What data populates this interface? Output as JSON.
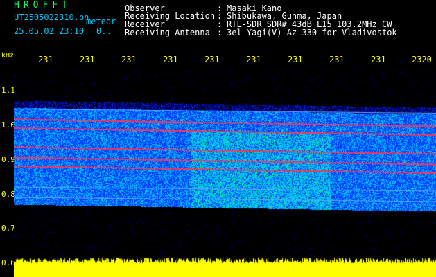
{
  "header": {
    "callsign": "HROFFT",
    "filename": "UT2505022310.pn",
    "meteor_tag": "meteor",
    "datetime": "25.05.02 23:10",
    "count": "0..",
    "fields": [
      {
        "label": "Observer",
        "value": "Masaki Kano"
      },
      {
        "label": "Receiving Location",
        "value": "Shibukawa, Gunma, Japan"
      },
      {
        "label": "Receiver",
        "value": "RTL-SDR SDR# 43dB L15 103.2MHz CW"
      },
      {
        "label": "Receiving Antenna",
        "value": "3el Yagi(V) Az 330 for Vladivostok"
      }
    ]
  },
  "axis": {
    "y_unit": "kHz",
    "y_ticks": [
      "1.1",
      "1.0",
      "0.9",
      "0.8",
      "0.7",
      "0.6"
    ],
    "x_ticks": [
      "231",
      "231",
      "231",
      "231",
      "231",
      "231",
      "231",
      "231",
      "231",
      "2320"
    ]
  },
  "spectrogram": {
    "freq_range_khz": [
      0.6,
      1.15
    ],
    "signal_band_khz": [
      0.76,
      1.04
    ],
    "red_traces_khz": [
      1.005,
      0.98,
      0.925,
      0.895,
      0.87
    ],
    "colors": {
      "bg": "#000033",
      "low": "#0000ff",
      "mid": "#00c8ff",
      "high": "#00ff66",
      "peak": "#ff3355",
      "noise": "#ffff00"
    }
  }
}
